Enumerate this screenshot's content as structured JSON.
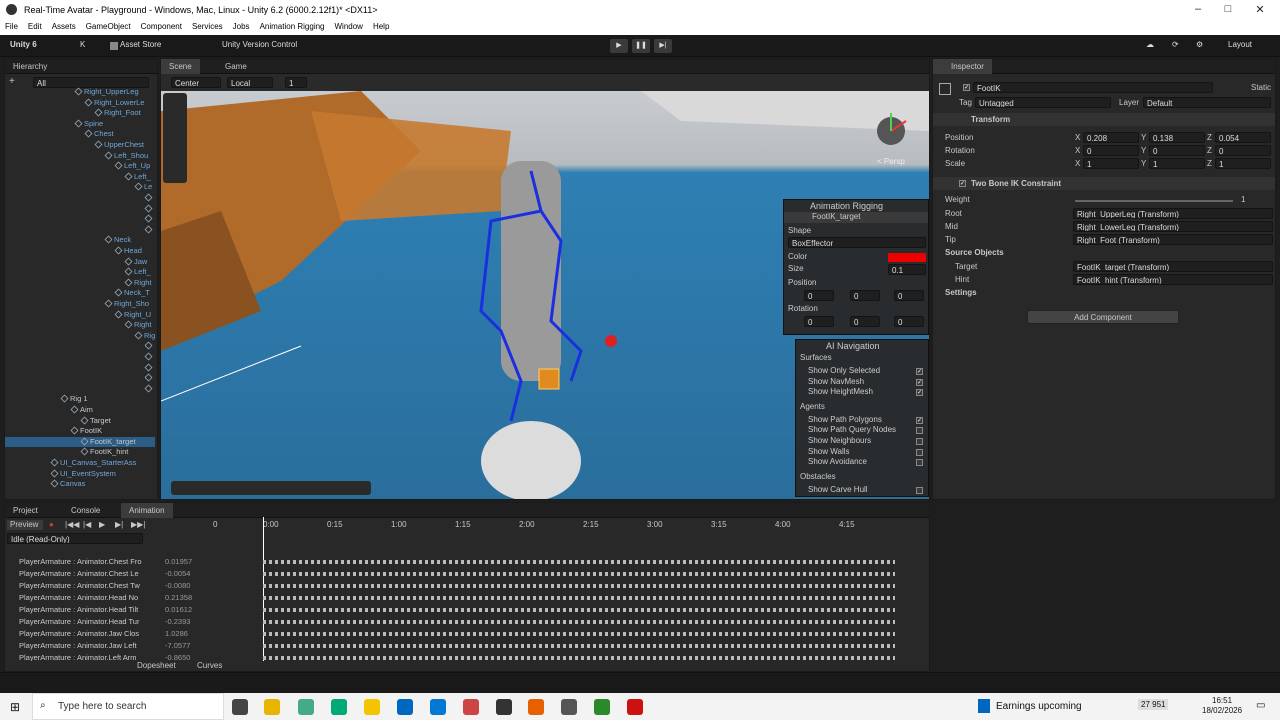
{
  "window": {
    "title": "Real-Time Avatar - Playground - Windows, Mac, Linux - Unity 6.2 (6000.2.12f1)* <DX11>"
  },
  "menu": [
    "File",
    "Edit",
    "Assets",
    "GameObject",
    "Component",
    "Services",
    "Jobs",
    "Animation Rigging",
    "Window",
    "Help"
  ],
  "toolbar": {
    "unity": "Unity 6",
    "account": "K",
    "asset_store": "Asset Store",
    "vcs": "Unity Version Control",
    "layout": "Layout"
  },
  "hierarchy": {
    "tab": "Hierarchy",
    "search_placeholder": "All",
    "rows": [
      {
        "label": "Right_UpperLeg",
        "indent": 70,
        "sel": false
      },
      {
        "label": "Right_LowerLe",
        "indent": 80,
        "sel": false
      },
      {
        "label": "Right_Foot",
        "indent": 90,
        "sel": false
      },
      {
        "label": "Spine",
        "indent": 70,
        "sel": false
      },
      {
        "label": "Chest",
        "indent": 80,
        "sel": false
      },
      {
        "label": "UpperChest",
        "indent": 90,
        "sel": false
      },
      {
        "label": "Left_Shou",
        "indent": 100,
        "sel": false
      },
      {
        "label": "Left_Up",
        "indent": 110,
        "sel": false
      },
      {
        "label": "Left_",
        "indent": 120,
        "sel": false
      },
      {
        "label": "Le",
        "indent": 130,
        "sel": false
      },
      {
        "label": "",
        "indent": 140,
        "sel": false
      },
      {
        "label": "",
        "indent": 140,
        "sel": false
      },
      {
        "label": "",
        "indent": 140,
        "sel": false
      },
      {
        "label": "",
        "indent": 140,
        "sel": false
      },
      {
        "label": "Neck",
        "indent": 100,
        "sel": false
      },
      {
        "label": "Head",
        "indent": 110,
        "sel": false
      },
      {
        "label": "Jaw",
        "indent": 120,
        "sel": false
      },
      {
        "label": "Left_",
        "indent": 120,
        "sel": false
      },
      {
        "label": "Right",
        "indent": 120,
        "sel": false
      },
      {
        "label": "Neck_T",
        "indent": 110,
        "sel": false
      },
      {
        "label": "Right_Sho",
        "indent": 100,
        "sel": false
      },
      {
        "label": "Right_U",
        "indent": 110,
        "sel": false
      },
      {
        "label": "Right",
        "indent": 120,
        "sel": false
      },
      {
        "label": "Rig",
        "indent": 130,
        "sel": false
      },
      {
        "label": "",
        "indent": 140,
        "sel": false
      },
      {
        "label": "",
        "indent": 140,
        "sel": false
      },
      {
        "label": "",
        "indent": 140,
        "sel": false
      },
      {
        "label": "",
        "indent": 140,
        "sel": false
      },
      {
        "label": "",
        "indent": 140,
        "sel": false
      },
      {
        "label": "Rig 1",
        "indent": 56,
        "sel": false
      },
      {
        "label": "Aim",
        "indent": 66,
        "sel": false
      },
      {
        "label": "Target",
        "indent": 76,
        "sel": false
      },
      {
        "label": "FootIK",
        "indent": 66,
        "sel": false
      },
      {
        "label": "FootIK_target",
        "indent": 76,
        "sel": true
      },
      {
        "label": "FootIK_hint",
        "indent": 76,
        "sel": false
      },
      {
        "label": "UI_Canvas_StarterAss",
        "indent": 46,
        "sel": false
      },
      {
        "label": "UI_EventSystem",
        "indent": 46,
        "sel": false
      },
      {
        "label": "Canvas",
        "indent": 46,
        "sel": false
      }
    ]
  },
  "scene": {
    "tabs": [
      "Scene",
      "Game"
    ],
    "pivot": "Center",
    "space": "Local",
    "snap": "1",
    "persp": "< Persp"
  },
  "rigging": {
    "title": "Animation Rigging",
    "target": "FootIK_target",
    "shape_label": "Shape",
    "shape": "BoxEffector",
    "color_label": "Color",
    "size_label": "Size",
    "size": "0.1",
    "position_label": "Position",
    "rotation_label": "Rotation",
    "x": "0",
    "y": "0",
    "z": "0"
  },
  "ainav": {
    "title": "AI Navigation",
    "sections": [
      {
        "head": "Surfaces",
        "items": [
          {
            "label": "Show Only Selected",
            "on": true
          },
          {
            "label": "Show NavMesh",
            "on": true
          },
          {
            "label": "Show HeightMesh",
            "on": true
          }
        ]
      },
      {
        "head": "Agents",
        "items": [
          {
            "label": "Show Path Polygons",
            "on": true
          },
          {
            "label": "Show Path Query Nodes",
            "on": false
          },
          {
            "label": "Show Neighbours",
            "on": false
          },
          {
            "label": "Show Walls",
            "on": false
          },
          {
            "label": "Show Avoidance",
            "on": false
          }
        ]
      },
      {
        "head": "Obstacles",
        "items": [
          {
            "label": "Show Carve Hull",
            "on": false
          }
        ]
      }
    ]
  },
  "inspector": {
    "tab": "Inspector",
    "name": "FootIK",
    "static": "Static",
    "tag_label": "Tag",
    "tag": "Untagged",
    "layer_label": "Layer",
    "layer": "Default",
    "transform": {
      "title": "Transform",
      "position": "Position",
      "rotation": "Rotation",
      "scale": "Scale",
      "pos": [
        "0.208",
        "0.138",
        "0.054"
      ],
      "rot": [
        "0",
        "0",
        "0"
      ],
      "scl": [
        "1",
        "1",
        "1"
      ]
    },
    "ik": {
      "title": "Two Bone IK Constraint",
      "weight_label": "Weight",
      "weight": "1",
      "root_label": "Root",
      "root": "Right_UpperLeg (Transform)",
      "mid_label": "Mid",
      "mid": "Right_LowerLeg (Transform)",
      "tip_label": "Tip",
      "tip": "Right_Foot (Transform)",
      "source": "Source Objects",
      "target_label": "Target",
      "target": "FootIK_target (Transform)",
      "hint_label": "Hint",
      "hint": "FootIK_hint (Transform)",
      "settings": "Settings"
    },
    "add": "Add Component"
  },
  "bottom": {
    "tabs": [
      "Project",
      "Console",
      "Animation"
    ],
    "preview": "Preview",
    "frame": "0",
    "clip": "Idle (Read-Only)",
    "ticks": [
      "0:00",
      "0:15",
      "1:00",
      "1:15",
      "2:00",
      "2:15",
      "3:00",
      "3:15",
      "4:00",
      "4:15"
    ],
    "props": [
      {
        "name": "PlayerArmature : Animator.Chest Fro",
        "val": "0.01957"
      },
      {
        "name": "PlayerArmature : Animator.Chest Le",
        "val": "-0.0054"
      },
      {
        "name": "PlayerArmature : Animator.Chest Tw",
        "val": "-0.0080"
      },
      {
        "name": "PlayerArmature : Animator.Head No",
        "val": "0.21358"
      },
      {
        "name": "PlayerArmature : Animator.Head Tilt",
        "val": "0.01612"
      },
      {
        "name": "PlayerArmature : Animator.Head Tur",
        "val": "-0.2393"
      },
      {
        "name": "PlayerArmature : Animator.Jaw Clos",
        "val": "1.0286"
      },
      {
        "name": "PlayerArmature : Animator.Jaw Left",
        "val": "-7.0577"
      },
      {
        "name": "PlayerArmature : Animator.Left Arm",
        "val": "-0.8650"
      }
    ],
    "dopesheet": "Dopesheet",
    "curves": "Curves"
  },
  "taskbar": {
    "search": "Type here to search",
    "news": "Earnings upcoming",
    "time": "16:51",
    "date": "18/02/2026",
    "stat": "27 951"
  }
}
